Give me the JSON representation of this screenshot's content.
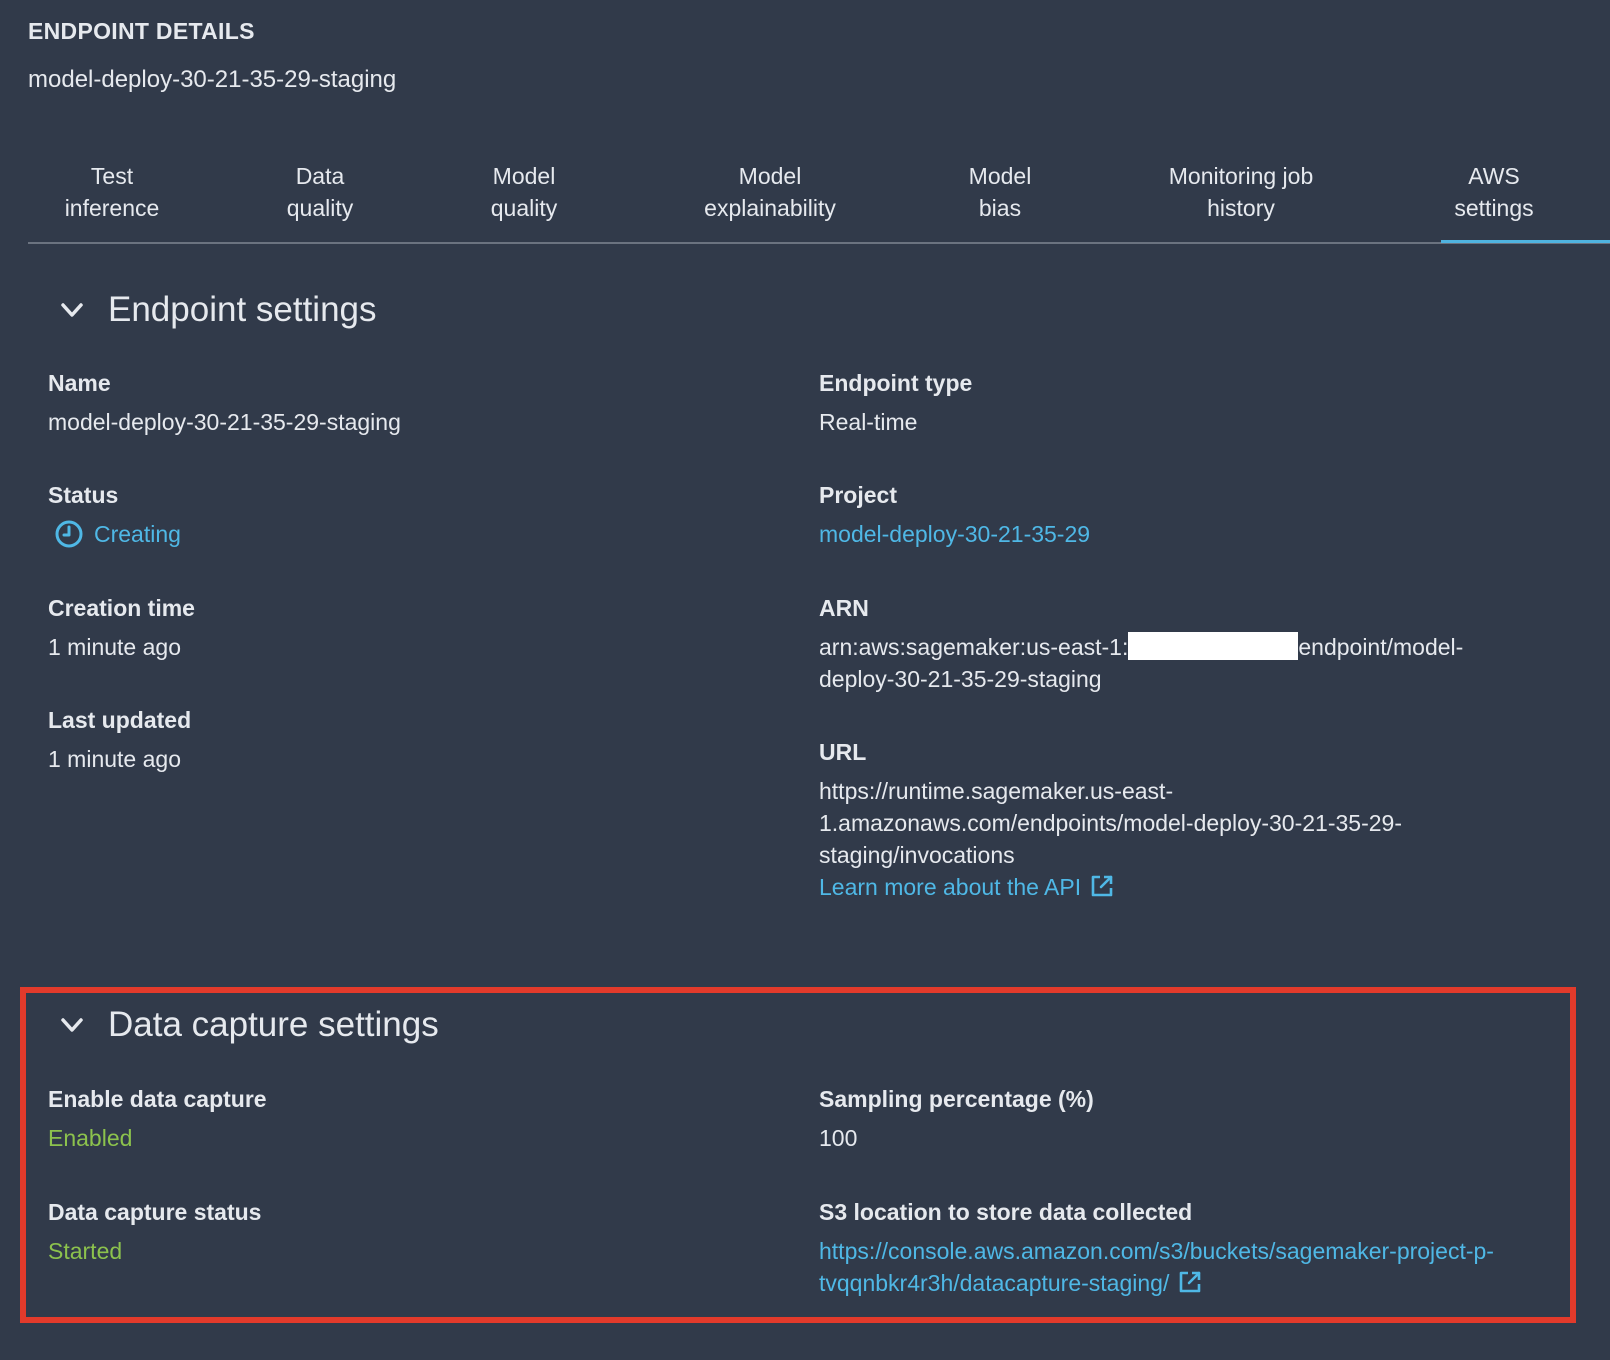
{
  "header": {
    "label": "ENDPOINT DETAILS",
    "endpoint_name": "model-deploy-30-21-35-29-staging"
  },
  "tabs": [
    {
      "label": "Test\ninference",
      "line1": "Test",
      "line2": "inference",
      "active": false
    },
    {
      "label": "Data\nquality",
      "line1": "Data",
      "line2": "quality",
      "active": false
    },
    {
      "label": "Model\nquality",
      "line1": "Model",
      "line2": "quality",
      "active": false
    },
    {
      "label": "Model\nexplainability",
      "line1": "Model",
      "line2": "explainability",
      "active": false
    },
    {
      "label": "Model\nbias",
      "line1": "Model",
      "line2": "bias",
      "active": false
    },
    {
      "label": "Monitoring job\nhistory",
      "line1": "Monitoring job",
      "line2": "history",
      "active": false
    },
    {
      "label": "AWS\nsettings",
      "line1": "AWS",
      "line2": "settings",
      "active": true
    }
  ],
  "endpoint_settings": {
    "title": "Endpoint settings",
    "name_label": "Name",
    "name_value": "model-deploy-30-21-35-29-staging",
    "status_label": "Status",
    "status_value": "Creating",
    "creation_label": "Creation time",
    "creation_value": "1 minute ago",
    "updated_label": "Last updated",
    "updated_value": "1 minute ago",
    "type_label": "Endpoint type",
    "type_value": "Real-time",
    "project_label": "Project",
    "project_value": "model-deploy-30-21-35-29",
    "arn_label": "ARN",
    "arn_prefix": "arn:aws:sagemaker:us-east-1:",
    "arn_suffix": "endpoint/model-",
    "arn_line2": "deploy-30-21-35-29-staging",
    "url_label": "URL",
    "url_line1": "https://runtime.sagemaker.us-east-",
    "url_line2": "1.amazonaws.com/endpoints/model-deploy-30-21-35-29-",
    "url_line3": "staging/invocations",
    "api_link": "Learn more about the API"
  },
  "data_capture": {
    "title": "Data capture settings",
    "enable_label": "Enable data capture",
    "enable_value": "Enabled",
    "status_label": "Data capture status",
    "status_value": "Started",
    "sampling_label": "Sampling percentage (%)",
    "sampling_value": "100",
    "s3_label": "S3 location to store data collected",
    "s3_line1": "https://console.aws.amazon.com/s3/buckets/sagemaker-project-p-",
    "s3_line2": "tvqqnbkr4r3h/datacapture-staging/"
  },
  "colors": {
    "background": "#313a4a",
    "link": "#4fb8e6",
    "success": "#8cc24d",
    "highlight": "#e23a2b",
    "tab_active_underline": "#4fb3e0"
  },
  "icons": {
    "chevron": "chevron-down-icon",
    "status": "clock-icon",
    "external": "external-link-icon"
  }
}
